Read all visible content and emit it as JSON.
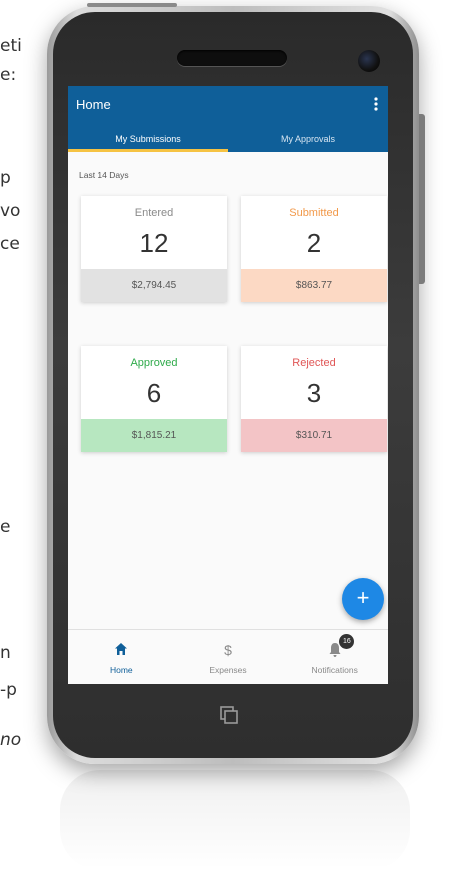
{
  "background_fragments": [
    "eti",
    "e:",
    "p",
    "vo",
    "ce",
    "e",
    "n",
    "-p",
    "no"
  ],
  "app": {
    "title": "Home",
    "tabs": [
      {
        "label": "My Submissions",
        "active": true
      },
      {
        "label": "My Approvals",
        "active": false
      }
    ],
    "period_label": "Last 14 Days",
    "cards": [
      {
        "status": "Entered",
        "count": "12",
        "amount": "$2,794.45",
        "head_color": "#8a8a8a",
        "amount_bg": "#e2e2e2"
      },
      {
        "status": "Submitted",
        "count": "2",
        "amount": "$863.77",
        "head_color": "#f2994a",
        "amount_bg": "#fcd9c4"
      },
      {
        "status": "Approved",
        "count": "6",
        "amount": "$1,815.21",
        "head_color": "#2eaa4a",
        "amount_bg": "#b7e7c0"
      },
      {
        "status": "Rejected",
        "count": "3",
        "amount": "$310.71",
        "head_color": "#e05656",
        "amount_bg": "#f3c4c6"
      }
    ],
    "fab_label": "+",
    "bottom_nav": [
      {
        "label": "Home",
        "icon": "home-icon",
        "active": true
      },
      {
        "label": "Expenses",
        "icon": "dollar-icon",
        "glyph": "$",
        "active": false
      },
      {
        "label": "Notifications",
        "icon": "bell-icon",
        "badge": "16",
        "active": false
      }
    ]
  },
  "colors": {
    "appbar": "#0f5f99",
    "tab_indicator": "#f6c343",
    "fab": "#1e88e5"
  }
}
